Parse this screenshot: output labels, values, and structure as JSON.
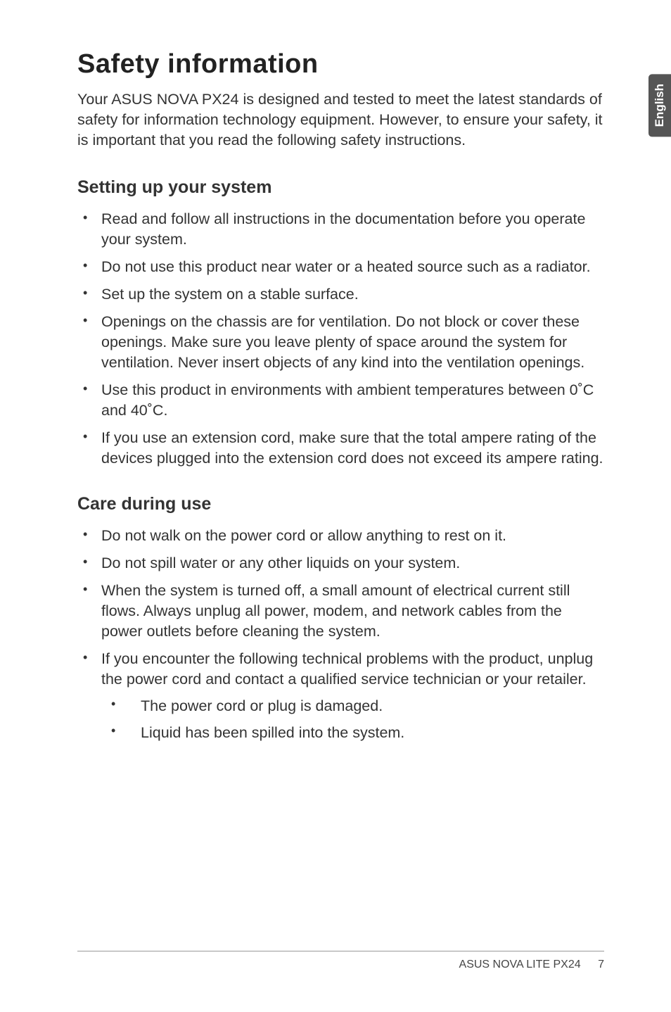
{
  "sideTab": "English",
  "heading": "Safety information",
  "intro": "Your ASUS NOVA PX24 is designed and tested to meet the latest standards of safety for information technology equipment. However, to ensure your safety, it is important that you read the following safety instructions.",
  "section1": {
    "title": "Setting up your system",
    "items": [
      "Read and follow all instructions in the documentation before you operate your system.",
      "Do not use this product near water or a heated source such as a radiator.",
      "Set up the system on a stable surface.",
      "Openings on the chassis are for ventilation. Do not block or cover these openings. Make sure you leave plenty of space around the system for ventilation. Never insert objects of any kind into the ventilation openings.",
      "Use this product in environments with ambient temperatures between 0˚C and 40˚C.",
      "If you use an extension cord, make sure that the total ampere rating of the devices plugged into the extension cord does not exceed its ampere rating."
    ]
  },
  "section2": {
    "title": "Care during use",
    "items": [
      "Do not walk on the power cord or allow anything to rest on it.",
      "Do not spill water or any other liquids on your system.",
      "When the system is turned off, a small amount of electrical current still flows. Always unplug all power, modem, and network cables from the power outlets before cleaning the system.",
      "If you encounter the following technical problems with the product, unplug the power cord and contact a qualified service technician or your retailer."
    ],
    "subItems": [
      "The power cord or plug is damaged.",
      "Liquid has been spilled into the system."
    ]
  },
  "footer": {
    "product": "ASUS NOVA LITE PX24",
    "page": "7"
  }
}
